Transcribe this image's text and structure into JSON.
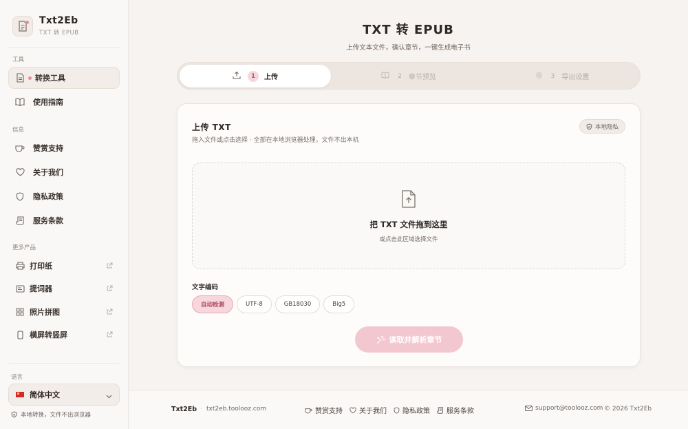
{
  "app": {
    "name": "Txt2Eb",
    "subtitle": "TXT 转 EPUB"
  },
  "sidebar": {
    "section_tools": "工具",
    "section_info": "信息",
    "section_more": "更多产品",
    "tools": [
      {
        "label": "转换工具",
        "icon": "document-icon",
        "active": true
      },
      {
        "label": "使用指南",
        "icon": "book-icon"
      }
    ],
    "info": [
      {
        "label": "赞赏支持",
        "icon": "coffee-icon"
      },
      {
        "label": "关于我们",
        "icon": "heart-icon"
      },
      {
        "label": "隐私政策",
        "icon": "shield-icon"
      },
      {
        "label": "服务条款",
        "icon": "scroll-icon"
      }
    ],
    "products": [
      {
        "label": "打印纸",
        "icon": "printer-icon"
      },
      {
        "label": "提词器",
        "icon": "teleprompter-icon"
      },
      {
        "label": "照片拼图",
        "icon": "grid-icon"
      },
      {
        "label": "横屏转竖屏",
        "icon": "phone-icon"
      }
    ],
    "language_label": "语言",
    "language_value": "简体中文",
    "local_note": "本地转换，文件不出浏览器"
  },
  "main": {
    "title": "TXT 转 EPUB",
    "subtitle": "上传文本文件，确认章节，一键生成电子书",
    "steps": [
      {
        "num": "1",
        "label": "上传",
        "icon": "upload-icon",
        "active": true
      },
      {
        "num": "2",
        "label": "章节预览",
        "icon": "book-icon"
      },
      {
        "num": "3",
        "label": "导出设置",
        "icon": "gear-icon"
      }
    ],
    "card": {
      "title": "上传 TXT",
      "description": "拖入文件或点击选择 · 全部在本地浏览器处理，文件不出本机",
      "privacy_badge": "本地隐私",
      "dropzone_title": "把 TXT 文件拖到这里",
      "dropzone_sub": "或点击此区域选择文件",
      "encoding_label": "文字编码",
      "encodings": [
        "自动检测",
        "UTF-8",
        "GB18030",
        "Big5"
      ],
      "selected_encoding": "自动检测",
      "parse_button": "读取并解析章节"
    }
  },
  "footer": {
    "brand": "Txt2Eb",
    "separator": "·",
    "site": "txt2eb.toolooz.com",
    "links": [
      {
        "label": "赞赏支持",
        "icon": "coffee-icon"
      },
      {
        "label": "关于我们",
        "icon": "heart-icon"
      },
      {
        "label": "隐私政策",
        "icon": "shield-icon"
      },
      {
        "label": "服务条款",
        "icon": "scroll-icon"
      }
    ],
    "email": "support@toolooz.com",
    "copyright": "© 2026 Txt2Eb"
  },
  "colors": {
    "accent": "#e58c9d",
    "accent_soft": "#f6d7dd",
    "button_disabled": "#f3c7d0"
  }
}
